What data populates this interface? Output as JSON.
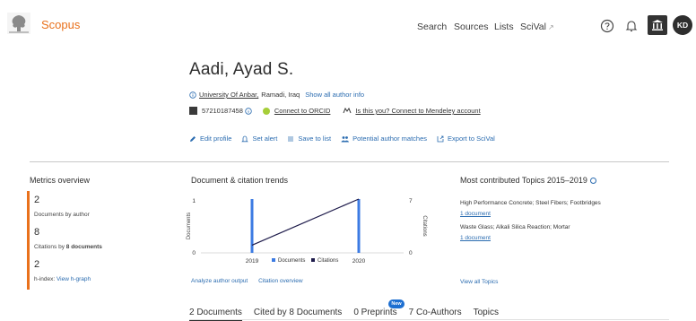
{
  "header": {
    "brand": "Scopus",
    "nav": {
      "search": "Search",
      "sources": "Sources",
      "lists": "Lists",
      "scival": "SciVal",
      "scival_ext": "↗"
    },
    "avatar_initials": "KD",
    "icons": [
      "help-icon",
      "bell-icon",
      "institution-icon"
    ]
  },
  "author": {
    "name": "Aadi, Ayad S.",
    "affiliation": "University Of Anbar,",
    "location": "Ramadi, Iraq",
    "show_all_info": "Show all author info",
    "author_id": "57210187458",
    "orcid_link": "Connect to ORCID",
    "mendeley_link": "Is this you? Connect to Mendeley account"
  },
  "actions": {
    "edit_profile": "Edit profile",
    "set_alert": "Set alert",
    "save_to_list": "Save to list",
    "potential_matches": "Potential author matches",
    "export_scival": "Export to SciVal"
  },
  "metrics": {
    "title": "Metrics overview",
    "documents_value": "2",
    "documents_label": "Documents by author",
    "citations_value": "8",
    "citations_label_prefix": "Citations by",
    "citations_label_bold": "8 documents",
    "hindex_value": "2",
    "hindex_label": "h-index:",
    "hindex_link": "View h-graph"
  },
  "trends": {
    "title": "Document & citation trends",
    "analyze_link": "Analyze author output",
    "citation_overview_link": "Citation overview"
  },
  "chart_data": {
    "type": "bar",
    "categories": [
      "2019",
      "2020"
    ],
    "series": [
      {
        "name": "Documents",
        "values": [
          1,
          1
        ],
        "axis": "left",
        "color": "#3c7be3"
      },
      {
        "name": "Citations",
        "values": [
          1,
          7
        ],
        "axis": "right",
        "type": "line",
        "color": "#1e1b4b"
      }
    ],
    "ylabel": "Documents",
    "y2label": "Citations",
    "ylim": [
      0,
      1
    ],
    "y2lim": [
      0,
      7
    ],
    "left_ticks": [
      "1",
      "0"
    ],
    "right_ticks": [
      "7",
      "0"
    ],
    "legend": "bottom"
  },
  "topics": {
    "title": "Most contributed Topics 2015–2019",
    "items": [
      {
        "name": "High Performance Concrete; Steel Fibers; Footbridges",
        "docs": "1 document"
      },
      {
        "name": "Waste Glass; Alkali Silica Reaction; Mortar",
        "docs": "1 document"
      }
    ],
    "view_all": "View all Topics"
  },
  "tabs": {
    "documents": "2 Documents",
    "cited_by": "Cited by 8 Documents",
    "preprints": "0 Preprints",
    "new_badge": "New",
    "coauthors": "7 Co-Authors",
    "topics": "Topics"
  }
}
